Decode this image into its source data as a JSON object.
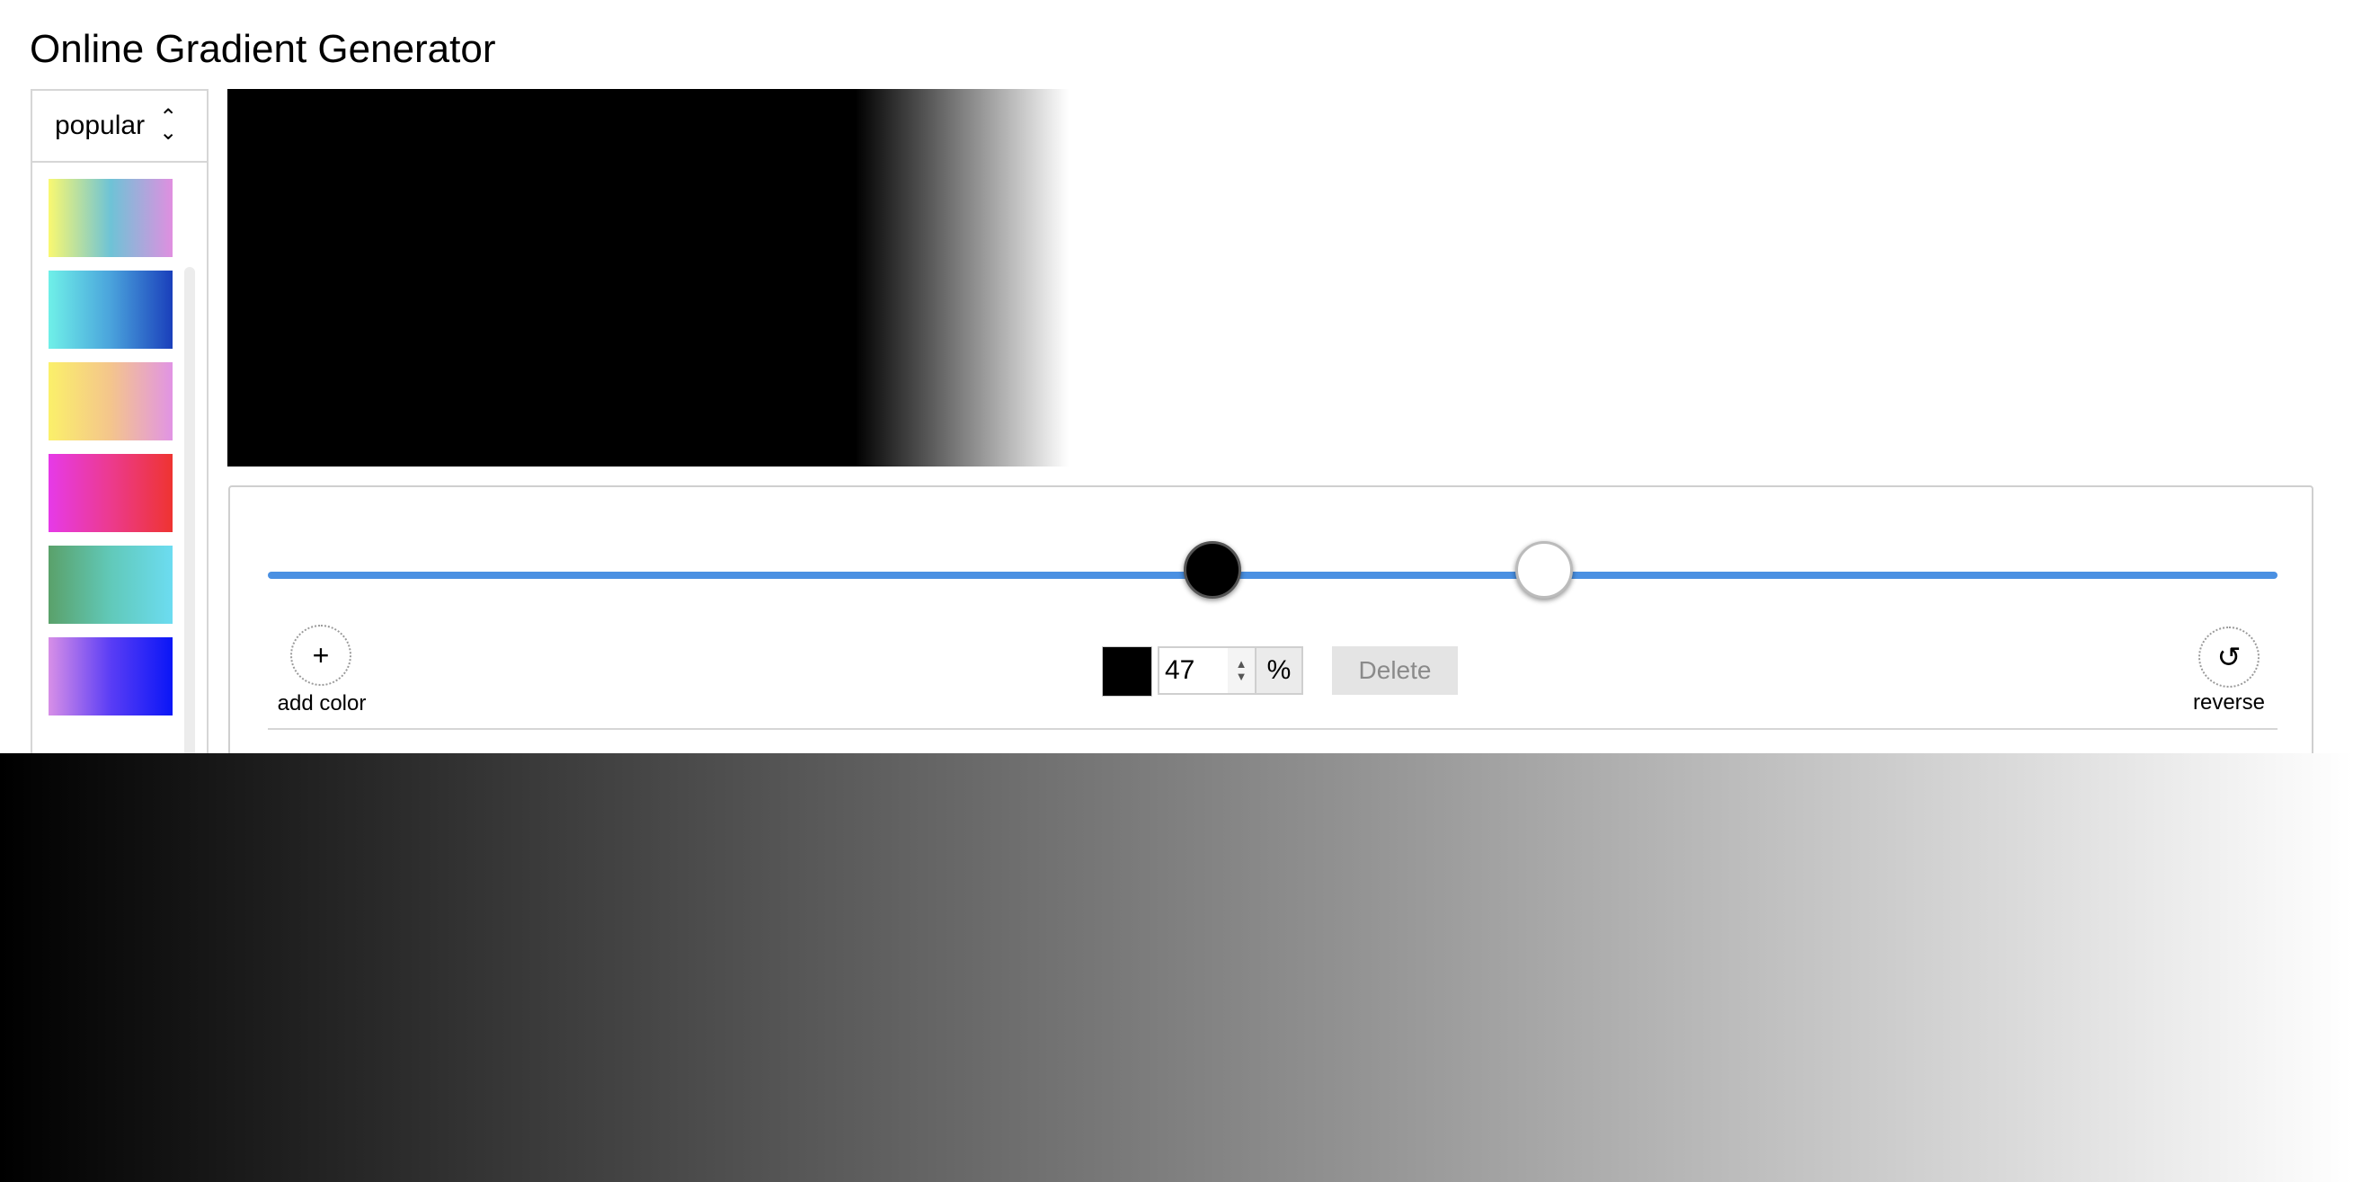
{
  "title": "Online Gradient Generator",
  "sidebar": {
    "select_label": "popular",
    "swatches": [
      {
        "from": "#f9f871",
        "via": "#6ec3d6",
        "to": "#e08fe0"
      },
      {
        "from": "#6ff0e8",
        "via": "#4aa3dc",
        "to": "#1a3fbb"
      },
      {
        "from": "#fbf06a",
        "via": "#f4c58c",
        "to": "#e194e4"
      },
      {
        "from": "#e63ae8",
        "via": "#ec3a8e",
        "to": "#ee3431"
      },
      {
        "from": "#5aa16a",
        "via": "#61c9b9",
        "to": "#6cdcf1"
      },
      {
        "from": "#d78fe7",
        "via": "#5a3df5",
        "to": "#0a16f6"
      }
    ]
  },
  "preview": {
    "gradient_stops": [
      {
        "color": "#000000",
        "position": 47
      },
      {
        "color": "#ffffff",
        "position": 63
      }
    ]
  },
  "controls": {
    "add_color_label": "add color",
    "add_icon": "+",
    "reverse_label": "reverse",
    "reverse_icon": "↺",
    "selected_color": "#000000",
    "position_value": "47",
    "percent_label": "%",
    "delete_label": "Delete",
    "spinner_up": "▲",
    "spinner_down": "▼",
    "select_up": "⌃",
    "select_down": "⌄"
  },
  "colors": {
    "accent": "#4a90e2",
    "border": "#cfcfcf"
  }
}
